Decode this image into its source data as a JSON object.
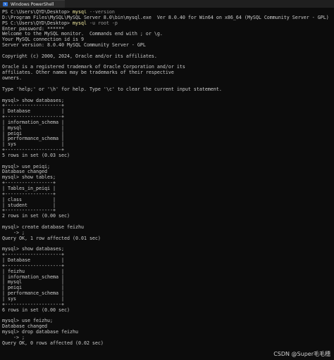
{
  "window": {
    "tab_title": "Windows PowerShell"
  },
  "terminal": {
    "lines": [
      {
        "text": "PS C:\\Users\\QYD\\Desktop> ",
        "cmd": "mysql",
        "param": " --version"
      },
      {
        "text": "D:\\Program Files\\MySQL\\MySQL Server 8.0\\bin\\mysql.exe  Ver 8.0.40 for Win64 on x86_64 (MySQL Community Server - GPL)"
      },
      {
        "text": "PS C:\\Users\\QYD\\Desktop> ",
        "cmd": "mysql",
        "param": " -u root -p"
      },
      {
        "text": "Enter password: ******"
      },
      {
        "text": "Welcome to the MySQL monitor.  Commands end with ; or \\g."
      },
      {
        "text": "Your MySQL connection id is 9"
      },
      {
        "text": "Server version: 8.0.40 MySQL Community Server - GPL"
      },
      {
        "text": ""
      },
      {
        "text": "Copyright (c) 2000, 2024, Oracle and/or its affiliates."
      },
      {
        "text": ""
      },
      {
        "text": "Oracle is a registered trademark of Oracle Corporation and/or its"
      },
      {
        "text": "affiliates. Other names may be trademarks of their respective"
      },
      {
        "text": "owners."
      },
      {
        "text": ""
      },
      {
        "text": "Type 'help;' or '\\h' for help. Type '\\c' to clear the current input statement."
      },
      {
        "text": ""
      },
      {
        "text": "mysql> show databases;"
      },
      {
        "text": "+--------------------+"
      },
      {
        "text": "| Database           |"
      },
      {
        "text": "+--------------------+"
      },
      {
        "text": "| information_schema |"
      },
      {
        "text": "| mysql              |"
      },
      {
        "text": "| peiqi              |"
      },
      {
        "text": "| performance_schema |"
      },
      {
        "text": "| sys                |"
      },
      {
        "text": "+--------------------+"
      },
      {
        "text": "5 rows in set (0.03 sec)"
      },
      {
        "text": ""
      },
      {
        "text": "mysql> use peiqi;"
      },
      {
        "text": "Database changed"
      },
      {
        "text": "mysql> show tables;"
      },
      {
        "text": "+-----------------+"
      },
      {
        "text": "| Tables_in_peiqi |"
      },
      {
        "text": "+-----------------+"
      },
      {
        "text": "| class           |"
      },
      {
        "text": "| student         |"
      },
      {
        "text": "+-----------------+"
      },
      {
        "text": "2 rows in set (0.00 sec)"
      },
      {
        "text": ""
      },
      {
        "text": "mysql> create database feizhu"
      },
      {
        "text": "    -> ;"
      },
      {
        "text": "Query OK, 1 row affected (0.01 sec)"
      },
      {
        "text": ""
      },
      {
        "text": "mysql> show databases;"
      },
      {
        "text": "+--------------------+"
      },
      {
        "text": "| Database           |"
      },
      {
        "text": "+--------------------+"
      },
      {
        "text": "| feizhu             |"
      },
      {
        "text": "| information_schema |"
      },
      {
        "text": "| mysql              |"
      },
      {
        "text": "| peiqi              |"
      },
      {
        "text": "| performance_schema |"
      },
      {
        "text": "| sys                |"
      },
      {
        "text": "+--------------------+"
      },
      {
        "text": "6 rows in set (0.00 sec)"
      },
      {
        "text": ""
      },
      {
        "text": "mysql> use feizhu;"
      },
      {
        "text": "Database changed"
      },
      {
        "text": "mysql> drop database feizhu"
      },
      {
        "text": "    -> ;"
      },
      {
        "text": "Query OK, 0 rows affected (0.02 sec)"
      },
      {
        "text": ""
      }
    ]
  },
  "watermark": "CSDN @Super毛毛穗",
  "colors": {
    "background": "#0c0c0c",
    "text": "#cccccc",
    "command": "#f9f1a5",
    "parameter": "#9a9a9a"
  }
}
